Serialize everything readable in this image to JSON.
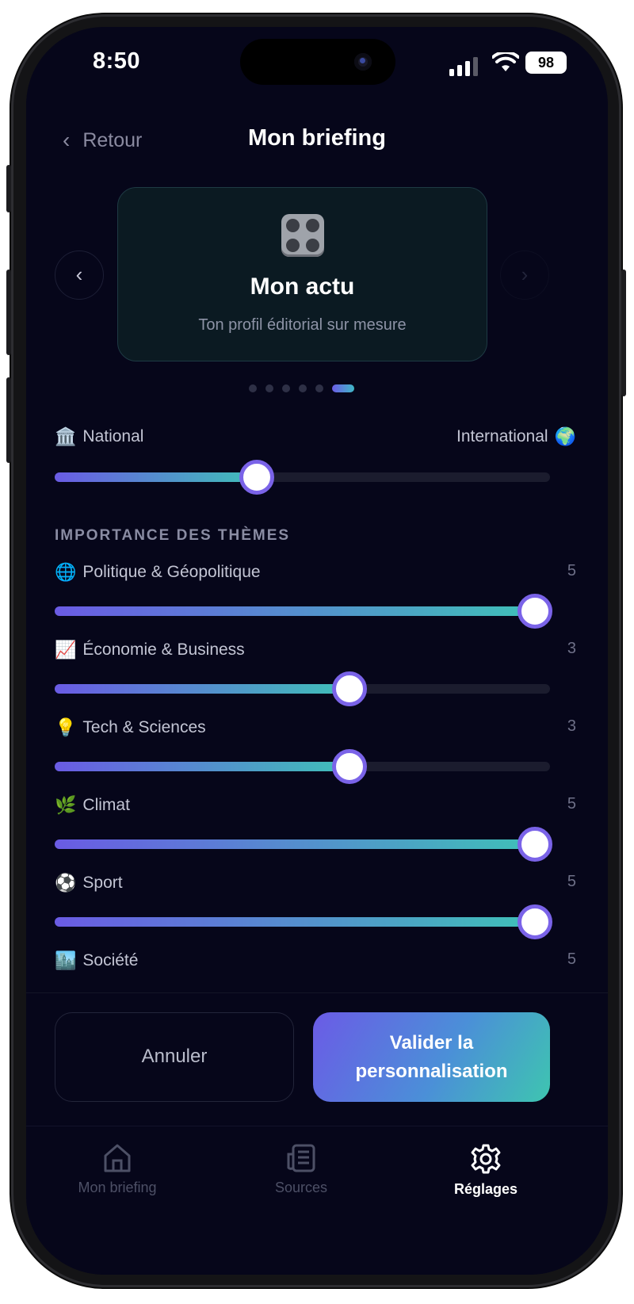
{
  "status_bar": {
    "time": "8:50",
    "battery": "98"
  },
  "header": {
    "back_label": "Retour",
    "title": "Mon briefing"
  },
  "card": {
    "title": "Mon actu",
    "subtitle": "Ton profil éditorial sur mesure"
  },
  "carousel": {
    "total_pages": 6,
    "active_page": 6
  },
  "scope_slider": {
    "left_label": "National",
    "left_icon": "🏛️",
    "right_label": "International",
    "right_icon": "🌍",
    "value_fraction": 0.408
  },
  "themes_section": {
    "title": "IMPORTANCE DES THÈMES",
    "items": [
      {
        "icon": "🌐",
        "label": "Politique & Géopolitique",
        "value": "5",
        "level": 5
      },
      {
        "icon": "📈",
        "label": "Économie & Business",
        "value": "3",
        "level": 3
      },
      {
        "icon": "💡",
        "label": "Tech & Sciences",
        "value": "3",
        "level": 3
      },
      {
        "icon": "🌿",
        "label": "Climat",
        "value": "5",
        "level": 5
      },
      {
        "icon": "⚽",
        "label": "Sport",
        "value": "5",
        "level": 5
      },
      {
        "icon": "🏙️",
        "label": "Société",
        "value": "5",
        "level": 5
      }
    ]
  },
  "actions": {
    "cancel_label": "Annuler",
    "validate_label": "Valider la personnalisation"
  },
  "tabbar": {
    "items": [
      {
        "label": "Mon briefing",
        "icon": "home-icon",
        "active": false
      },
      {
        "label": "Sources",
        "icon": "newspaper-icon",
        "active": false
      },
      {
        "label": "Réglages",
        "icon": "gear-icon",
        "active": true
      }
    ]
  },
  "colors": {
    "background": "#06061a",
    "accent_start": "#6a5be4",
    "accent_end": "#3fc0b8",
    "thumb_border": "#7a63e8"
  }
}
